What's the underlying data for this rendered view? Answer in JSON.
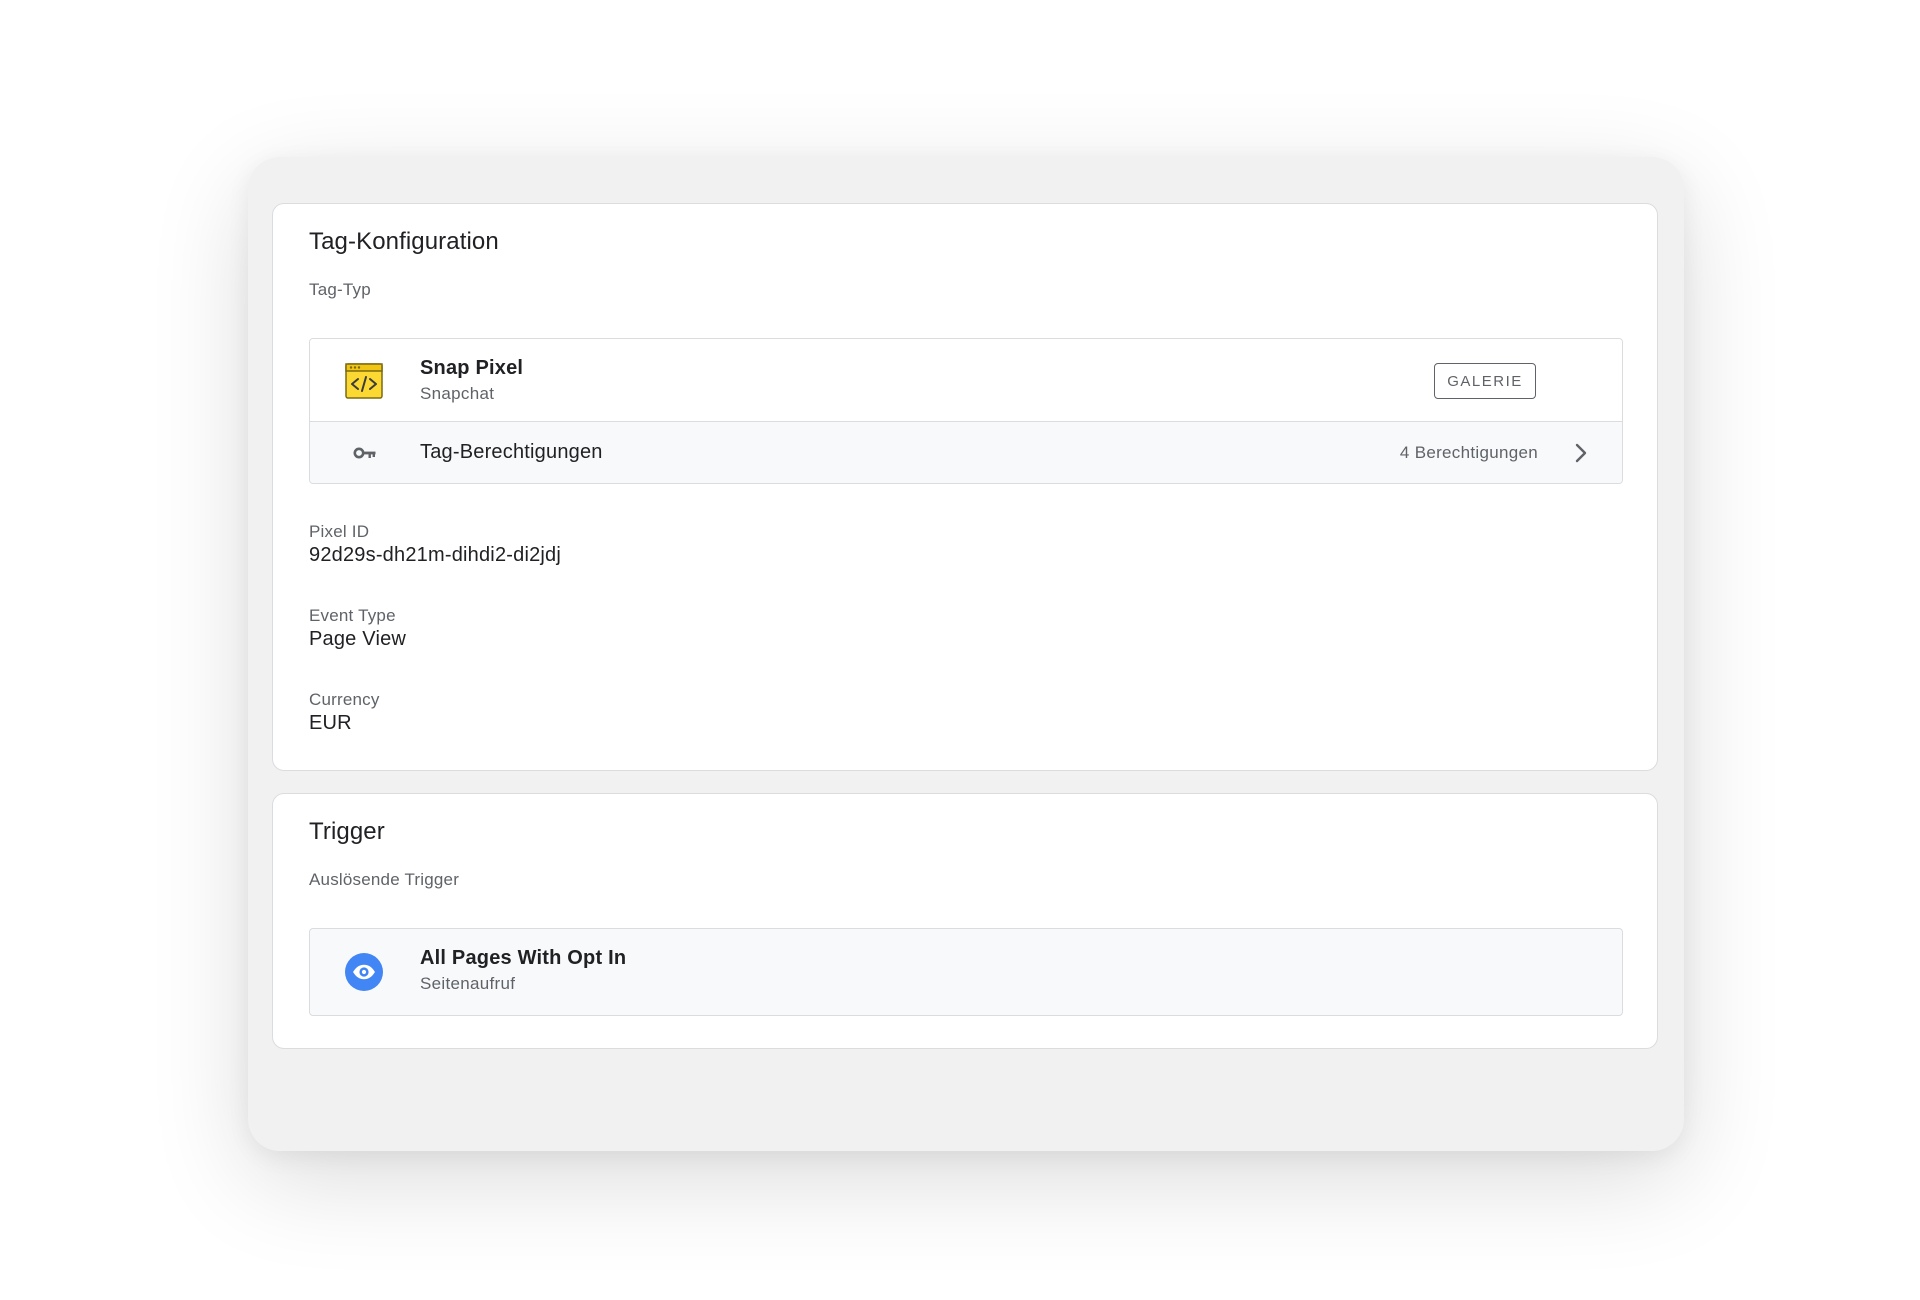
{
  "tag_config": {
    "title": "Tag-Konfiguration",
    "tag_type_label": "Tag-Typ",
    "tag": {
      "name": "Snap Pixel",
      "vendor": "Snapchat",
      "icon": "code-window-icon",
      "icon_color": "#fbd932",
      "gallery_button": "GALERIE"
    },
    "permissions": {
      "label": "Tag-Berechtigungen",
      "count_text": "4 Berechtigungen",
      "icon": "key-icon"
    },
    "fields": [
      {
        "label": "Pixel ID",
        "value": "92d29s-dh21m-dihdi2-di2jdj"
      },
      {
        "label": "Event Type",
        "value": "Page View"
      },
      {
        "label": "Currency",
        "value": "EUR"
      }
    ]
  },
  "trigger": {
    "title": "Trigger",
    "firing_label": "Auslösende Trigger",
    "item": {
      "name": "All Pages With Opt In",
      "type": "Seitenaufruf",
      "icon": "eye-icon",
      "icon_color": "#4285f4"
    }
  }
}
